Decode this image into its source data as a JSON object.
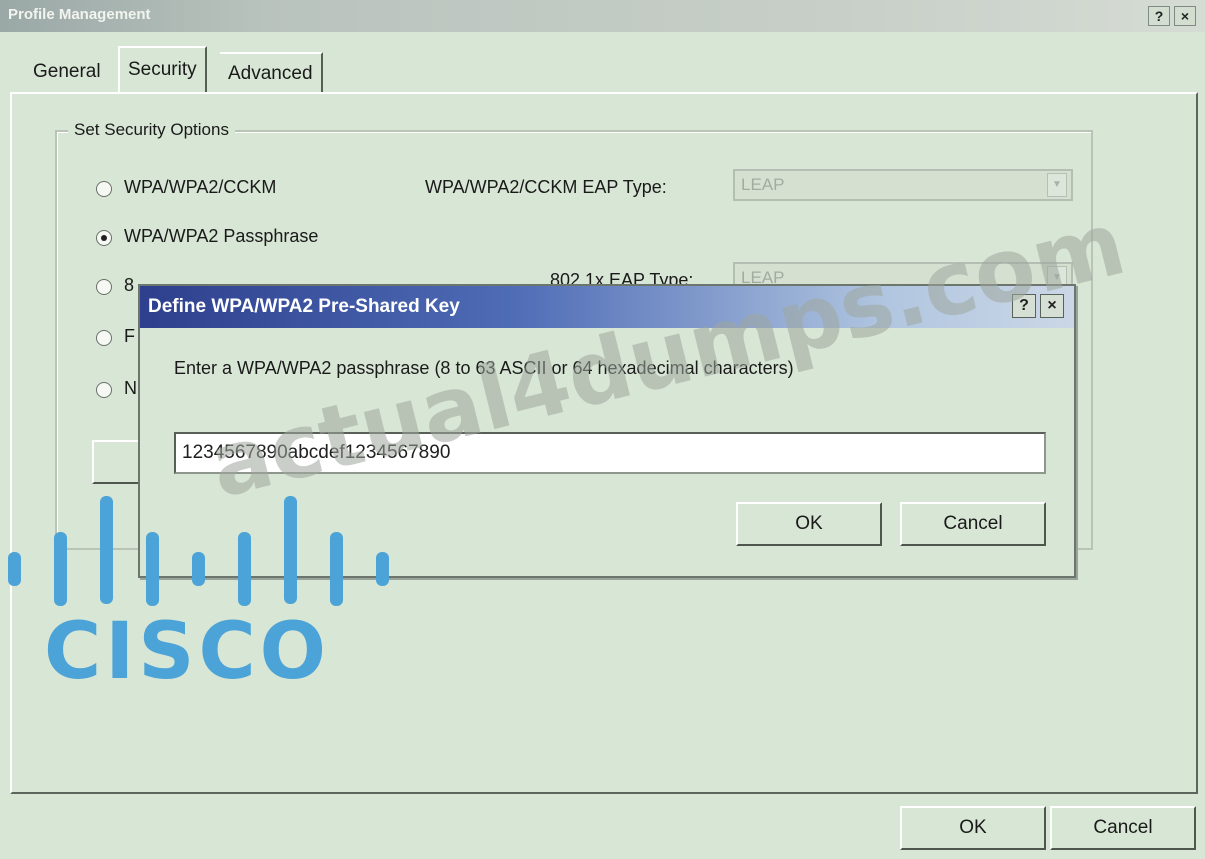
{
  "window": {
    "title": "Profile Management",
    "help_btn": "?",
    "close_btn": "×"
  },
  "tabs": [
    {
      "label": "General",
      "active": false
    },
    {
      "label": "Security",
      "active": true
    },
    {
      "label": "Advanced",
      "active": false
    }
  ],
  "security": {
    "group_label": "Set Security Options",
    "options": [
      {
        "label": "WPA/WPA2/CCKM",
        "selected": false
      },
      {
        "label": "WPA/WPA2 Passphrase",
        "selected": true
      },
      {
        "label": "8",
        "selected": false
      },
      {
        "label": "F",
        "selected": false
      },
      {
        "label": "N",
        "selected": false
      }
    ],
    "eap_type": {
      "label": "WPA/WPA2/CCKM EAP Type:",
      "value": "LEAP"
    },
    "eap_8021x": {
      "label": "802.1x EAP Type:",
      "value": "LEAP"
    }
  },
  "footer": {
    "ok_label": "OK",
    "cancel_label": "Cancel"
  },
  "modal": {
    "title": "Define WPA/WPA2 Pre-Shared Key",
    "help_btn": "?",
    "close_btn": "×",
    "prompt": "Enter a WPA/WPA2 passphrase (8 to 63 ASCII or 64 hexadecimal characters)",
    "passphrase": "1234567890abcdef1234567890",
    "ok_label": "OK",
    "cancel_label": "Cancel"
  },
  "logo": {
    "text": "CISCO",
    "color": "#4ba3d8"
  },
  "watermark": "actual4dumps.com"
}
